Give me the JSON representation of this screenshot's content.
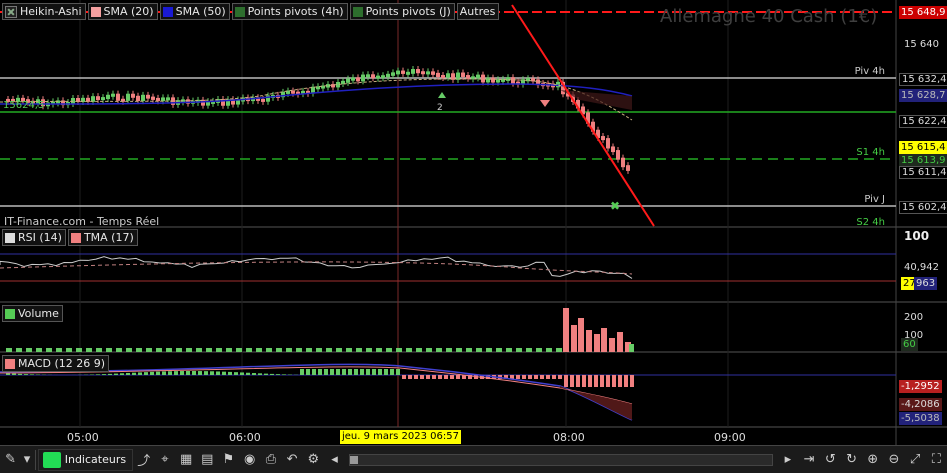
{
  "legend": {
    "items": [
      {
        "label": "Heikin-Ashi",
        "color": "#2d6e2d",
        "icon": "close-x-icon"
      },
      {
        "label": "SMA (20)",
        "color": "#f4a0a0",
        "icon": "color-swatch"
      },
      {
        "label": "SMA (50)",
        "color": "#1a1ad4",
        "icon": "color-swatch"
      },
      {
        "label": "Points pivots (4h)",
        "color": "#2d6e2d",
        "icon": "color-swatch"
      },
      {
        "label": "Points pivots (J)",
        "color": "#2d6e2d",
        "icon": "color-swatch"
      },
      {
        "label": "Autres",
        "color": "",
        "icon": ""
      }
    ]
  },
  "watermark": "Allemagne 40 Cash (1€)",
  "source_label": "IT-Finance.com - Temps Réel",
  "left_price_label": "15624,5",
  "pivot_labels": {
    "piv4h": "Piv 4h",
    "s1_4h": "S1 4h",
    "pivj": "Piv J",
    "s2_4h": "S2 4h"
  },
  "price_axis": {
    "tags": [
      "15 648,9",
      "15 640",
      "15 632,4",
      "15 628,7",
      "15 622,4",
      "15 615,4",
      "15 613,9",
      "15 611,4",
      "15 602,4"
    ]
  },
  "rsi": {
    "label1": "RSI (14)",
    "label2": "TMA (17)",
    "axis_top": "100",
    "axis_value": "40,942",
    "axis_value2": "27",
    "axis_value3": "963"
  },
  "volume": {
    "label": "Volume",
    "axis_200": "200",
    "axis_100": "100",
    "axis_value": "60"
  },
  "macd": {
    "label": "MACD (12 26 9)",
    "v1": "-1,2952",
    "v2": "-4,2086",
    "v3": "-5,5038"
  },
  "time_axis": {
    "labels": [
      "05:00",
      "06:00",
      "08:00",
      "09:00"
    ],
    "cursor": "jeu. 9 mars 2023 06:57"
  },
  "toolbar": {
    "indicators_label": "Indicateurs"
  },
  "colors": {
    "bull": "#66cc66",
    "bear": "#f08080",
    "red_line": "#ff1a1a",
    "sma50": "#2020c0",
    "pivot_green": "#22aa22"
  },
  "chart_data": {
    "type": "candlestick",
    "title": "Allemagne 40 Cash (1€)",
    "ylim": [
      15600,
      15652
    ],
    "x_labels": [
      "05:00",
      "06:00",
      "08:00",
      "09:00"
    ],
    "levels": [
      {
        "name": "Piv 4h",
        "value": 15632.4
      },
      {
        "name": "S1 4h",
        "value": 15615.4
      },
      {
        "name": "Piv J",
        "value": 15602.4
      },
      {
        "name": "S2 4h",
        "value": 15600.0
      }
    ],
    "last_price": 15611.4
  }
}
